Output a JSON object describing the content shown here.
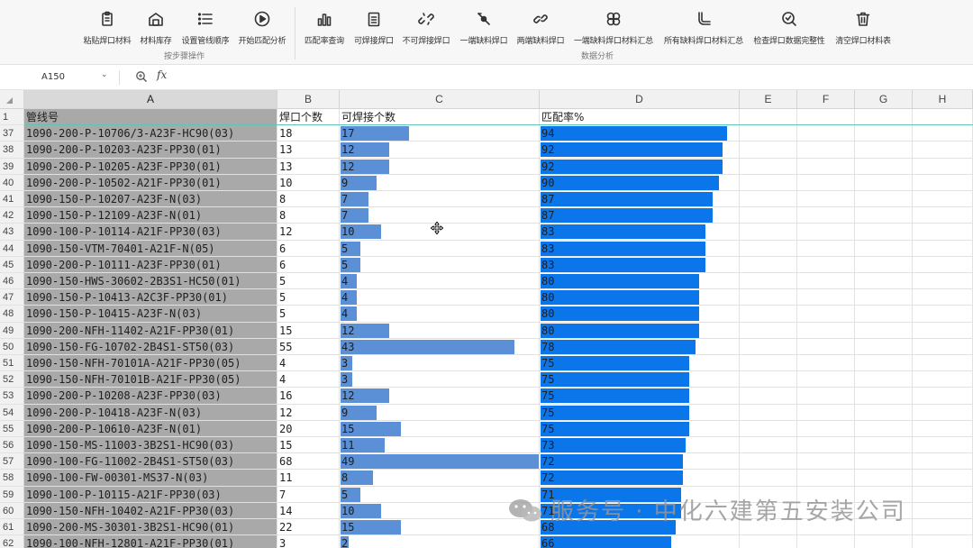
{
  "ribbon": {
    "buttons": [
      {
        "label": "粘贴焊口材料",
        "icon": "clipboard-icon"
      },
      {
        "label": "材料库存",
        "icon": "warehouse-icon"
      },
      {
        "label": "设置管线顺序",
        "icon": "list-order-icon"
      },
      {
        "label": "开始匹配分析",
        "icon": "play-icon"
      },
      {
        "label": "匹配率查询",
        "icon": "bar-chart-icon"
      },
      {
        "label": "可焊接焊口",
        "icon": "checklist-icon"
      },
      {
        "label": "不可焊接焊口",
        "icon": "broken-link-icon"
      },
      {
        "label": "一端缺料焊口",
        "icon": "pipe-end-icon"
      },
      {
        "label": "两端缺料焊口",
        "icon": "link-icon"
      },
      {
        "label": "一端缺料焊口材料汇总",
        "icon": "cluster-icon"
      },
      {
        "label": "所有缺料焊口材料汇总",
        "icon": "pipe-elbow-icon"
      },
      {
        "label": "检查焊口数据完整性",
        "icon": "check-search-icon"
      },
      {
        "label": "清空焊口材料表",
        "icon": "trash-icon"
      }
    ],
    "groups": [
      {
        "label": "按步骤操作"
      },
      {
        "label": "数据分析"
      }
    ]
  },
  "formula_bar": {
    "cell_ref": "A150",
    "fx": "fx"
  },
  "columns": [
    "A",
    "B",
    "C",
    "D",
    "E",
    "F",
    "G",
    "H"
  ],
  "header_row": {
    "num": "1",
    "a": "管线号",
    "b": "焊口个数",
    "c": "可焊接个数",
    "d": "匹配率%"
  },
  "max_c": 49,
  "rows": [
    {
      "num": "37",
      "a": "1090-200-P-10706/3-A23F-HC90(03)",
      "b": "18",
      "c": 17,
      "d": 94
    },
    {
      "num": "38",
      "a": "1090-200-P-10203-A23F-PP30(01)",
      "b": "13",
      "c": 12,
      "d": 92
    },
    {
      "num": "39",
      "a": "1090-200-P-10205-A23F-PP30(01)",
      "b": "13",
      "c": 12,
      "d": 92
    },
    {
      "num": "40",
      "a": "1090-200-P-10502-A21F-PP30(01)",
      "b": "10",
      "c": 9,
      "d": 90
    },
    {
      "num": "41",
      "a": "1090-150-P-10207-A23F-N(03)",
      "b": "8",
      "c": 7,
      "d": 87
    },
    {
      "num": "42",
      "a": "1090-150-P-12109-A23F-N(01)",
      "b": "8",
      "c": 7,
      "d": 87
    },
    {
      "num": "43",
      "a": "1090-100-P-10114-A21F-PP30(03)",
      "b": "12",
      "c": 10,
      "d": 83
    },
    {
      "num": "44",
      "a": "1090-150-VTM-70401-A21F-N(05)",
      "b": "6",
      "c": 5,
      "d": 83
    },
    {
      "num": "45",
      "a": "1090-200-P-10111-A23F-PP30(01)",
      "b": "6",
      "c": 5,
      "d": 83
    },
    {
      "num": "46",
      "a": "1090-150-HWS-30602-2B3S1-HC50(01)",
      "b": "5",
      "c": 4,
      "d": 80
    },
    {
      "num": "47",
      "a": "1090-150-P-10413-A2C3F-PP30(01)",
      "b": "5",
      "c": 4,
      "d": 80
    },
    {
      "num": "48",
      "a": "1090-150-P-10415-A23F-N(03)",
      "b": "5",
      "c": 4,
      "d": 80
    },
    {
      "num": "49",
      "a": "1090-200-NFH-11402-A21F-PP30(01)",
      "b": "15",
      "c": 12,
      "d": 80
    },
    {
      "num": "50",
      "a": "1090-150-FG-10702-2B4S1-ST50(03)",
      "b": "55",
      "c": 43,
      "d": 78
    },
    {
      "num": "51",
      "a": "1090-150-NFH-70101A-A21F-PP30(05)",
      "b": "4",
      "c": 3,
      "d": 75
    },
    {
      "num": "52",
      "a": "1090-150-NFH-70101B-A21F-PP30(05)",
      "b": "4",
      "c": 3,
      "d": 75
    },
    {
      "num": "53",
      "a": "1090-200-P-10208-A23F-PP30(03)",
      "b": "16",
      "c": 12,
      "d": 75
    },
    {
      "num": "54",
      "a": "1090-200-P-10418-A23F-N(03)",
      "b": "12",
      "c": 9,
      "d": 75
    },
    {
      "num": "55",
      "a": "1090-200-P-10610-A23F-N(01)",
      "b": "20",
      "c": 15,
      "d": 75
    },
    {
      "num": "56",
      "a": "1090-150-MS-11003-3B2S1-HC90(03)",
      "b": "15",
      "c": 11,
      "d": 73
    },
    {
      "num": "57",
      "a": "1090-100-FG-11002-2B4S1-ST50(03)",
      "b": "68",
      "c": 49,
      "d": 72
    },
    {
      "num": "58",
      "a": "1090-100-FW-00301-MS37-N(03)",
      "b": "11",
      "c": 8,
      "d": 72
    },
    {
      "num": "59",
      "a": "1090-100-P-10115-A21F-PP30(03)",
      "b": "7",
      "c": 5,
      "d": 71
    },
    {
      "num": "60",
      "a": "1090-150-NFH-10402-A21F-PP30(03)",
      "b": "14",
      "c": 10,
      "d": 71
    },
    {
      "num": "61",
      "a": "1090-200-MS-30301-3B2S1-HC90(01)",
      "b": "22",
      "c": 15,
      "d": 68
    },
    {
      "num": "62",
      "a": "1090-100-NFH-12801-A21F-PP30(01)",
      "b": "3",
      "c": 2,
      "d": 66
    }
  ],
  "watermark": {
    "text": "服务号 · 中化六建第五安装公司",
    "icon": "wechat-logo-icon"
  },
  "colors": {
    "c_bar": "#5b8fd6",
    "d_bar": "#0b76e9",
    "column_a_fill": "#a9a9a9"
  }
}
